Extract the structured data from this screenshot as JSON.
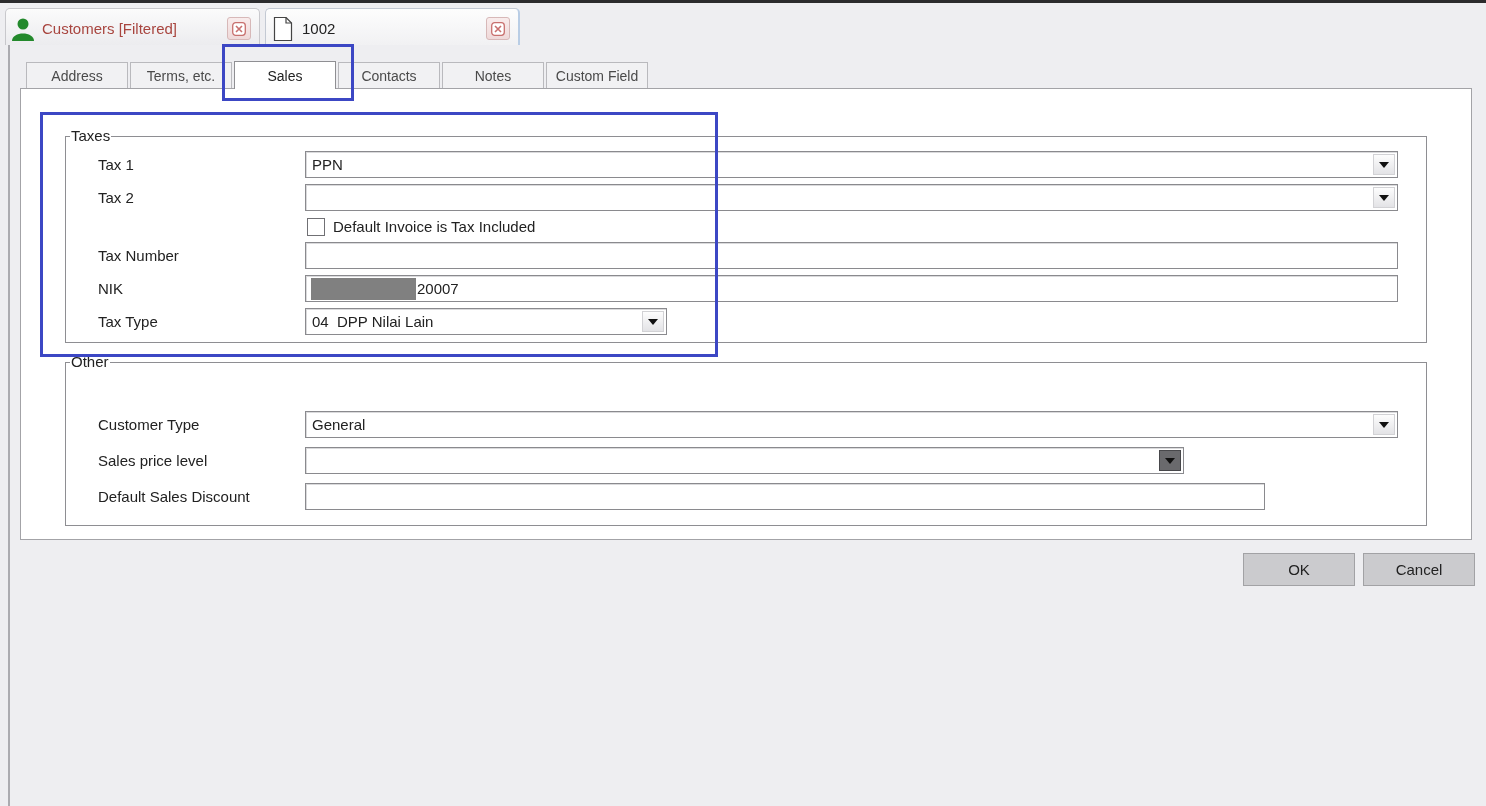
{
  "document_tabs": [
    {
      "kind": "list",
      "label": "Customers [Filtered]",
      "selected": false
    },
    {
      "kind": "record",
      "label": "1002",
      "selected": true
    }
  ],
  "form_tabs": [
    {
      "label": "Address",
      "selected": false,
      "highlighted": false
    },
    {
      "label": "Terms, etc.",
      "selected": false,
      "highlighted": false
    },
    {
      "label": "Sales",
      "selected": true,
      "highlighted": true
    },
    {
      "label": "Contacts",
      "selected": false,
      "highlighted": false
    },
    {
      "label": "Notes",
      "selected": false,
      "highlighted": false
    },
    {
      "label": "Custom Field",
      "selected": false,
      "highlighted": false
    }
  ],
  "groups": [
    {
      "title": "Taxes",
      "highlighted": true,
      "fields": [
        {
          "kind": "dropdown",
          "label": "Tax 1",
          "value": "PPN",
          "hovered": false
        },
        {
          "kind": "dropdown",
          "label": "Tax 2",
          "hovered": false
        },
        {
          "kind": "checkbox",
          "label": "Default Invoice is Tax Included",
          "checked": false
        },
        {
          "kind": "text",
          "label": "Tax Number",
          "redacted": false
        },
        {
          "kind": "text",
          "label": "NIK",
          "value": "20007",
          "redacted": true
        },
        {
          "kind": "dropdown",
          "label": "Tax Type",
          "value": "04  DPP Nilai Lain",
          "hovered": false
        }
      ]
    },
    {
      "title": "Other",
      "highlighted": false,
      "fields": [
        {
          "kind": "dropdown",
          "label": "Customer Type",
          "value": "General",
          "hovered": false
        },
        {
          "kind": "dropdown",
          "label": "Sales price level",
          "hovered": true
        },
        {
          "kind": "text",
          "label": "Default Sales Discount",
          "redacted": false
        }
      ]
    }
  ],
  "buttons": [
    {
      "label": "OK"
    },
    {
      "label": "Cancel"
    }
  ]
}
